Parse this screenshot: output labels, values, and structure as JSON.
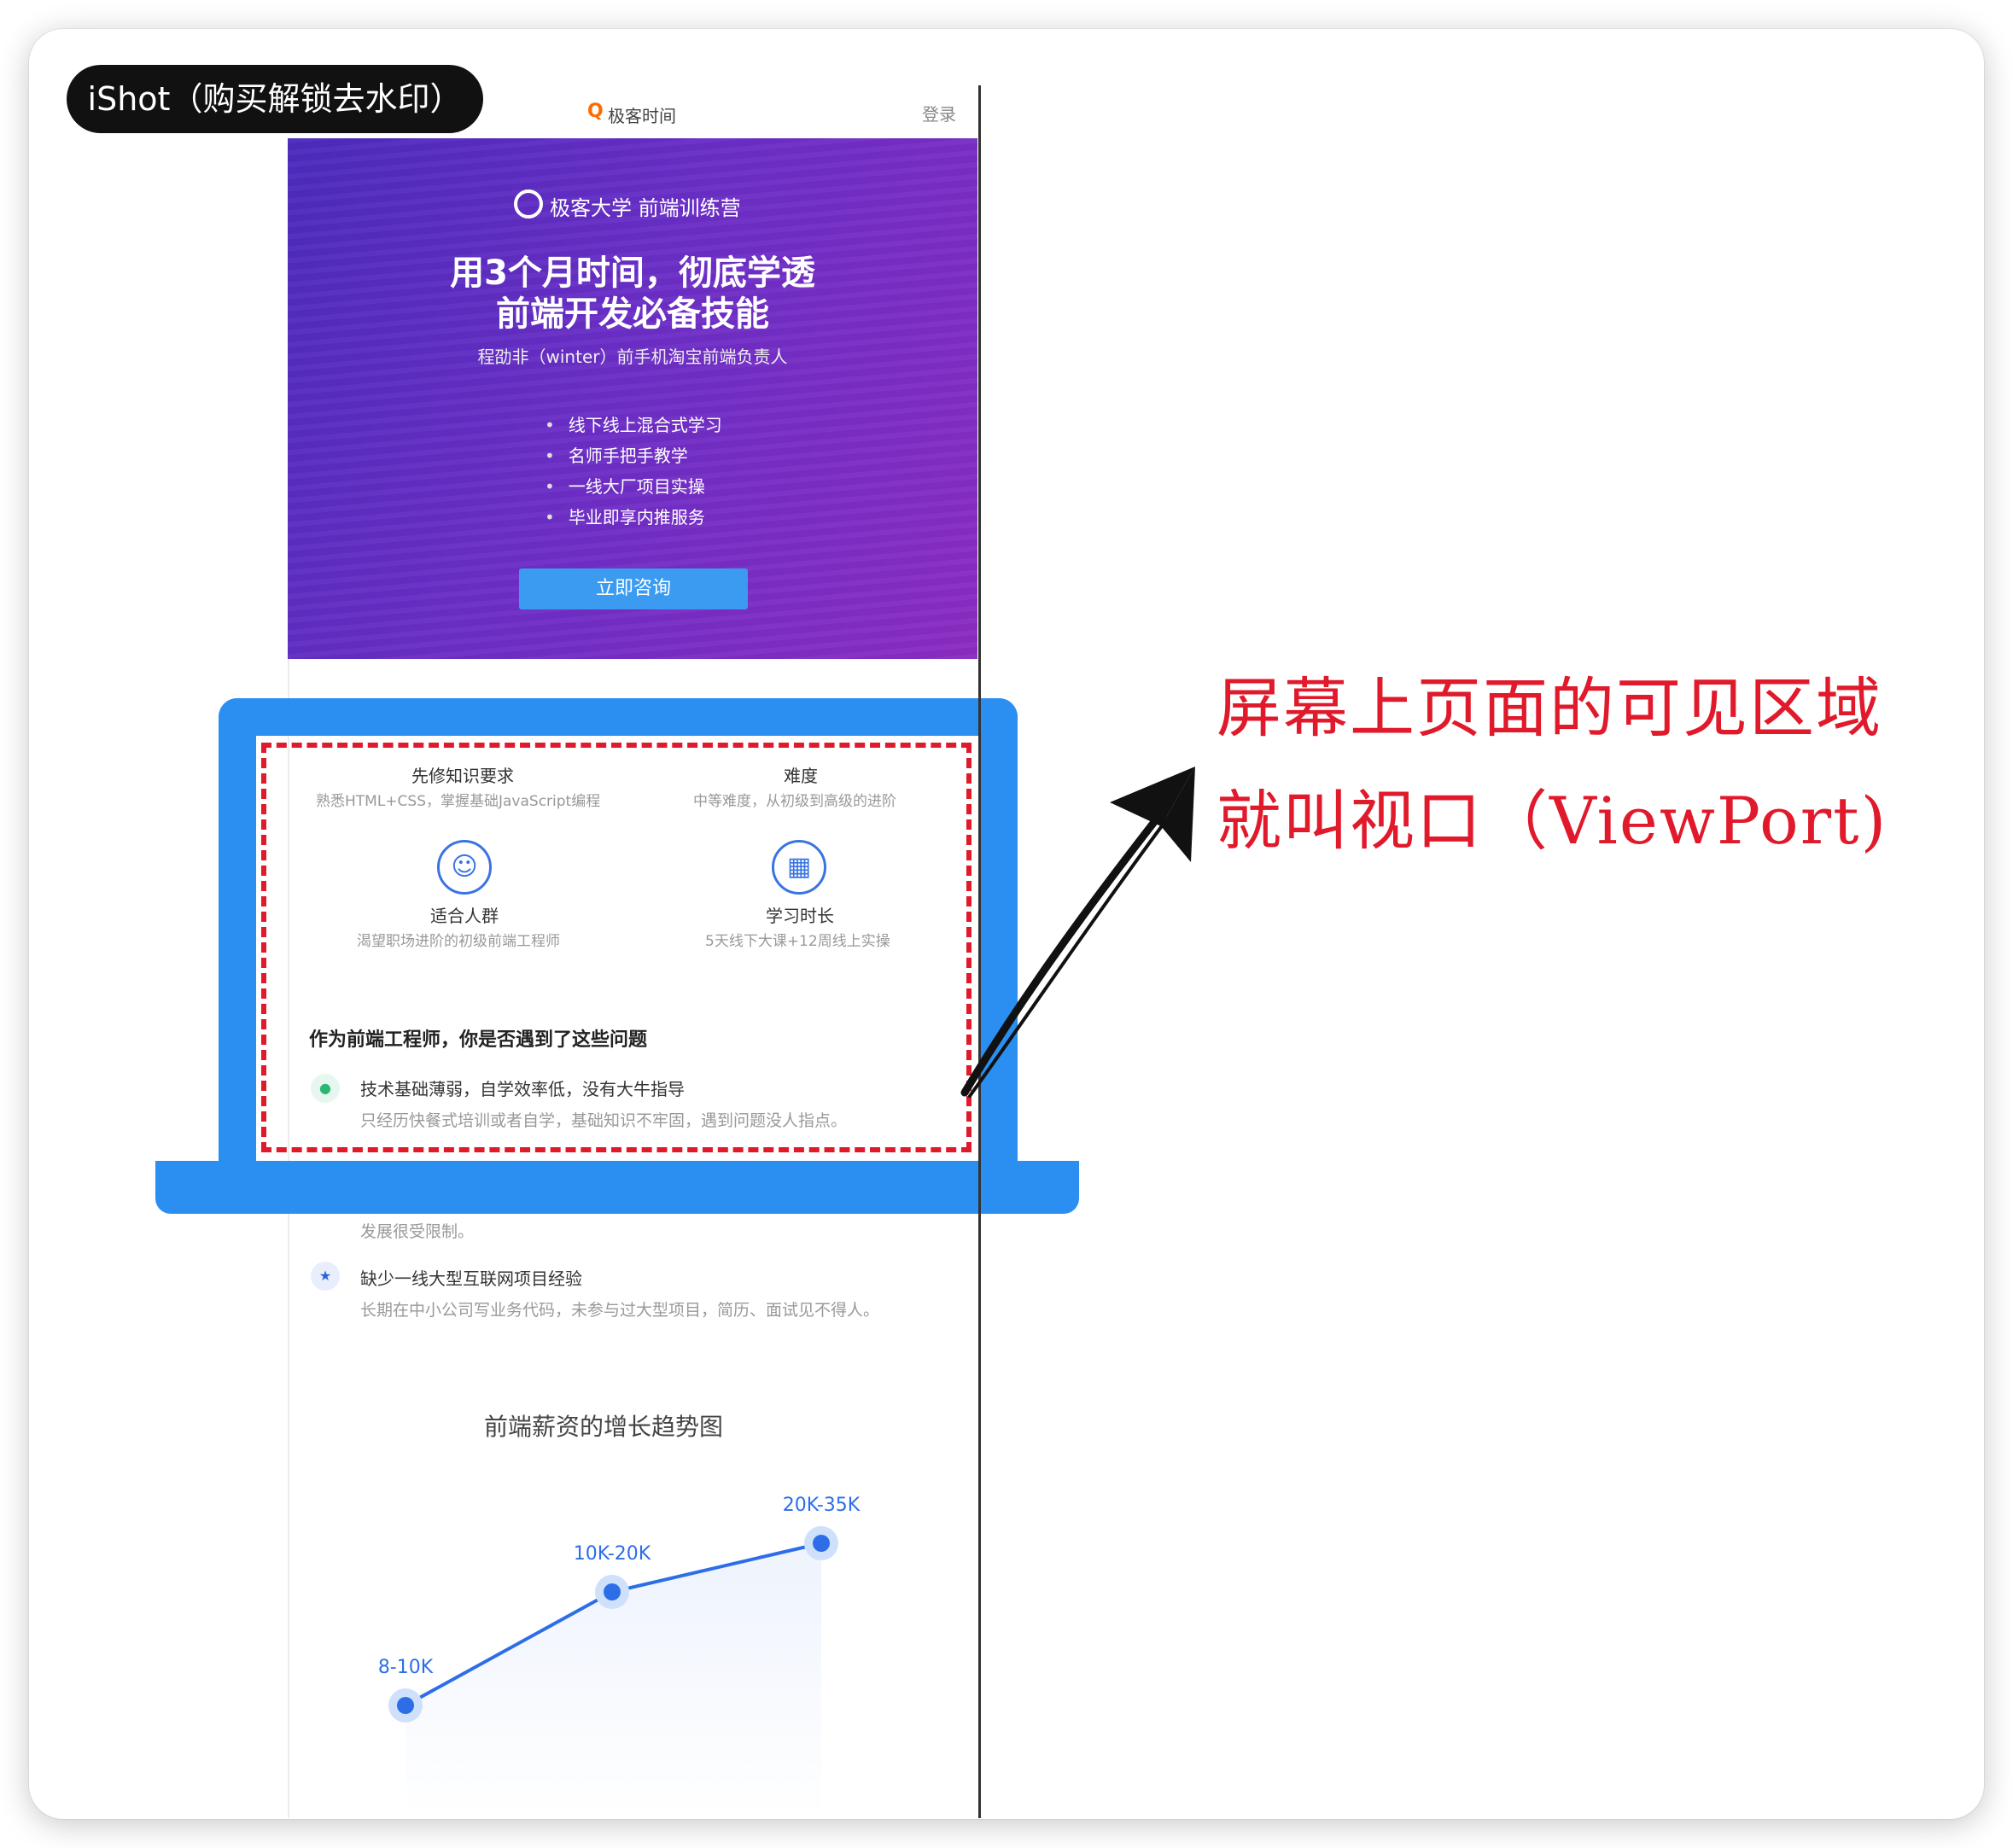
{
  "watermark": "iShot（购买解锁去水印）",
  "site": {
    "logo_text": "极客时间",
    "login": "登录"
  },
  "hero": {
    "brand": "极客大学  前端训练营",
    "headline_1": "用3个月时间，彻底学透",
    "headline_2": "前端开发必备技能",
    "subtitle": "程劭非（winter）前手机淘宝前端负责人",
    "bullets": [
      "线下线上混合式学习",
      "名师手把手教学",
      "一线大厂项目实操",
      "毕业即享内推服务"
    ],
    "cta": "立即咨询"
  },
  "info": {
    "prereq_label": "先修知识要求",
    "prereq_desc": "熟悉HTML+CSS，掌握基础JavaScript编程",
    "difficulty_label": "难度",
    "difficulty_desc": "中等难度，从初级到高级的进阶",
    "audience_label": "适合人群",
    "audience_desc": "渴望职场进阶的初级前端工程师",
    "duration_label": "学习时长",
    "duration_desc": "5天线下大课+12周线上实操"
  },
  "questions": {
    "title": "作为前端工程师，你是否遇到了这些问题",
    "items": [
      {
        "heading": "技术基础薄弱，自学效率低，没有大牛指导",
        "desc": "只经历快餐式培训或者自学，基础知识不牢固，遇到问题没人指点。"
      },
      {
        "heading": "",
        "desc": "发展很受限制。"
      },
      {
        "heading": "缺少一线大型互联网项目经验",
        "desc": "长期在中小公司写业务代码，未参与过大型项目，简历、面试见不得人。"
      }
    ]
  },
  "chart_data": {
    "type": "line",
    "title": "前端薪资的增长趋势图",
    "categories": [
      "8-10K",
      "10K-20K",
      "20K-35K"
    ],
    "values": [
      1,
      2,
      3
    ],
    "point_labels": [
      "8-10K",
      "10K-20K",
      "20K-35K"
    ],
    "xlabel": "",
    "ylabel": "",
    "grid": false,
    "colors": {
      "line": "#2d6ee8",
      "area": "#eef3fd"
    }
  },
  "annotation": {
    "line1": "屏幕上页面的可见区域",
    "line2": "就叫视口（ViewPort)"
  },
  "colors": {
    "laptop": "#2a8ff0",
    "viewport_border": "#e0192b",
    "hero_start": "#4b2bbd",
    "hero_end": "#8a2cc2",
    "cta": "#3a9bf0"
  }
}
